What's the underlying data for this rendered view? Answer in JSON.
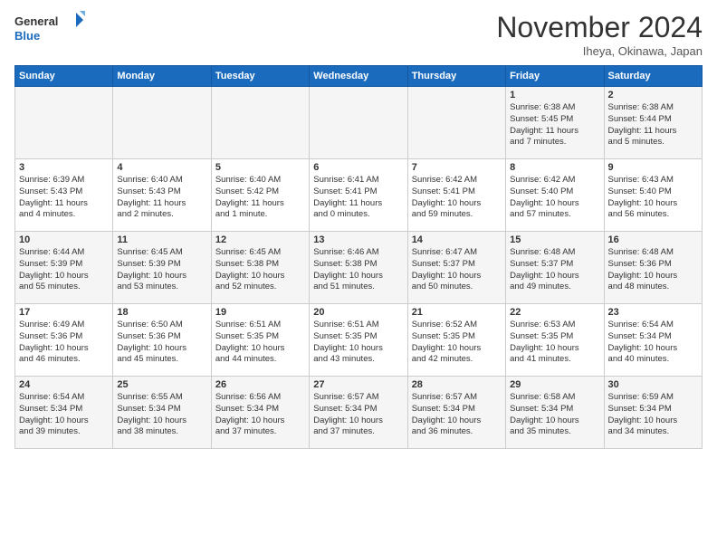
{
  "header": {
    "logo_line1": "General",
    "logo_line2": "Blue",
    "month": "November 2024",
    "location": "Iheya, Okinawa, Japan"
  },
  "days_of_week": [
    "Sunday",
    "Monday",
    "Tuesday",
    "Wednesday",
    "Thursday",
    "Friday",
    "Saturday"
  ],
  "weeks": [
    [
      {
        "day": "",
        "info": ""
      },
      {
        "day": "",
        "info": ""
      },
      {
        "day": "",
        "info": ""
      },
      {
        "day": "",
        "info": ""
      },
      {
        "day": "",
        "info": ""
      },
      {
        "day": "1",
        "info": "Sunrise: 6:38 AM\nSunset: 5:45 PM\nDaylight: 11 hours\nand 7 minutes."
      },
      {
        "day": "2",
        "info": "Sunrise: 6:38 AM\nSunset: 5:44 PM\nDaylight: 11 hours\nand 5 minutes."
      }
    ],
    [
      {
        "day": "3",
        "info": "Sunrise: 6:39 AM\nSunset: 5:43 PM\nDaylight: 11 hours\nand 4 minutes."
      },
      {
        "day": "4",
        "info": "Sunrise: 6:40 AM\nSunset: 5:43 PM\nDaylight: 11 hours\nand 2 minutes."
      },
      {
        "day": "5",
        "info": "Sunrise: 6:40 AM\nSunset: 5:42 PM\nDaylight: 11 hours\nand 1 minute."
      },
      {
        "day": "6",
        "info": "Sunrise: 6:41 AM\nSunset: 5:41 PM\nDaylight: 11 hours\nand 0 minutes."
      },
      {
        "day": "7",
        "info": "Sunrise: 6:42 AM\nSunset: 5:41 PM\nDaylight: 10 hours\nand 59 minutes."
      },
      {
        "day": "8",
        "info": "Sunrise: 6:42 AM\nSunset: 5:40 PM\nDaylight: 10 hours\nand 57 minutes."
      },
      {
        "day": "9",
        "info": "Sunrise: 6:43 AM\nSunset: 5:40 PM\nDaylight: 10 hours\nand 56 minutes."
      }
    ],
    [
      {
        "day": "10",
        "info": "Sunrise: 6:44 AM\nSunset: 5:39 PM\nDaylight: 10 hours\nand 55 minutes."
      },
      {
        "day": "11",
        "info": "Sunrise: 6:45 AM\nSunset: 5:39 PM\nDaylight: 10 hours\nand 53 minutes."
      },
      {
        "day": "12",
        "info": "Sunrise: 6:45 AM\nSunset: 5:38 PM\nDaylight: 10 hours\nand 52 minutes."
      },
      {
        "day": "13",
        "info": "Sunrise: 6:46 AM\nSunset: 5:38 PM\nDaylight: 10 hours\nand 51 minutes."
      },
      {
        "day": "14",
        "info": "Sunrise: 6:47 AM\nSunset: 5:37 PM\nDaylight: 10 hours\nand 50 minutes."
      },
      {
        "day": "15",
        "info": "Sunrise: 6:48 AM\nSunset: 5:37 PM\nDaylight: 10 hours\nand 49 minutes."
      },
      {
        "day": "16",
        "info": "Sunrise: 6:48 AM\nSunset: 5:36 PM\nDaylight: 10 hours\nand 48 minutes."
      }
    ],
    [
      {
        "day": "17",
        "info": "Sunrise: 6:49 AM\nSunset: 5:36 PM\nDaylight: 10 hours\nand 46 minutes."
      },
      {
        "day": "18",
        "info": "Sunrise: 6:50 AM\nSunset: 5:36 PM\nDaylight: 10 hours\nand 45 minutes."
      },
      {
        "day": "19",
        "info": "Sunrise: 6:51 AM\nSunset: 5:35 PM\nDaylight: 10 hours\nand 44 minutes."
      },
      {
        "day": "20",
        "info": "Sunrise: 6:51 AM\nSunset: 5:35 PM\nDaylight: 10 hours\nand 43 minutes."
      },
      {
        "day": "21",
        "info": "Sunrise: 6:52 AM\nSunset: 5:35 PM\nDaylight: 10 hours\nand 42 minutes."
      },
      {
        "day": "22",
        "info": "Sunrise: 6:53 AM\nSunset: 5:35 PM\nDaylight: 10 hours\nand 41 minutes."
      },
      {
        "day": "23",
        "info": "Sunrise: 6:54 AM\nSunset: 5:34 PM\nDaylight: 10 hours\nand 40 minutes."
      }
    ],
    [
      {
        "day": "24",
        "info": "Sunrise: 6:54 AM\nSunset: 5:34 PM\nDaylight: 10 hours\nand 39 minutes."
      },
      {
        "day": "25",
        "info": "Sunrise: 6:55 AM\nSunset: 5:34 PM\nDaylight: 10 hours\nand 38 minutes."
      },
      {
        "day": "26",
        "info": "Sunrise: 6:56 AM\nSunset: 5:34 PM\nDaylight: 10 hours\nand 37 minutes."
      },
      {
        "day": "27",
        "info": "Sunrise: 6:57 AM\nSunset: 5:34 PM\nDaylight: 10 hours\nand 37 minutes."
      },
      {
        "day": "28",
        "info": "Sunrise: 6:57 AM\nSunset: 5:34 PM\nDaylight: 10 hours\nand 36 minutes."
      },
      {
        "day": "29",
        "info": "Sunrise: 6:58 AM\nSunset: 5:34 PM\nDaylight: 10 hours\nand 35 minutes."
      },
      {
        "day": "30",
        "info": "Sunrise: 6:59 AM\nSunset: 5:34 PM\nDaylight: 10 hours\nand 34 minutes."
      }
    ]
  ]
}
